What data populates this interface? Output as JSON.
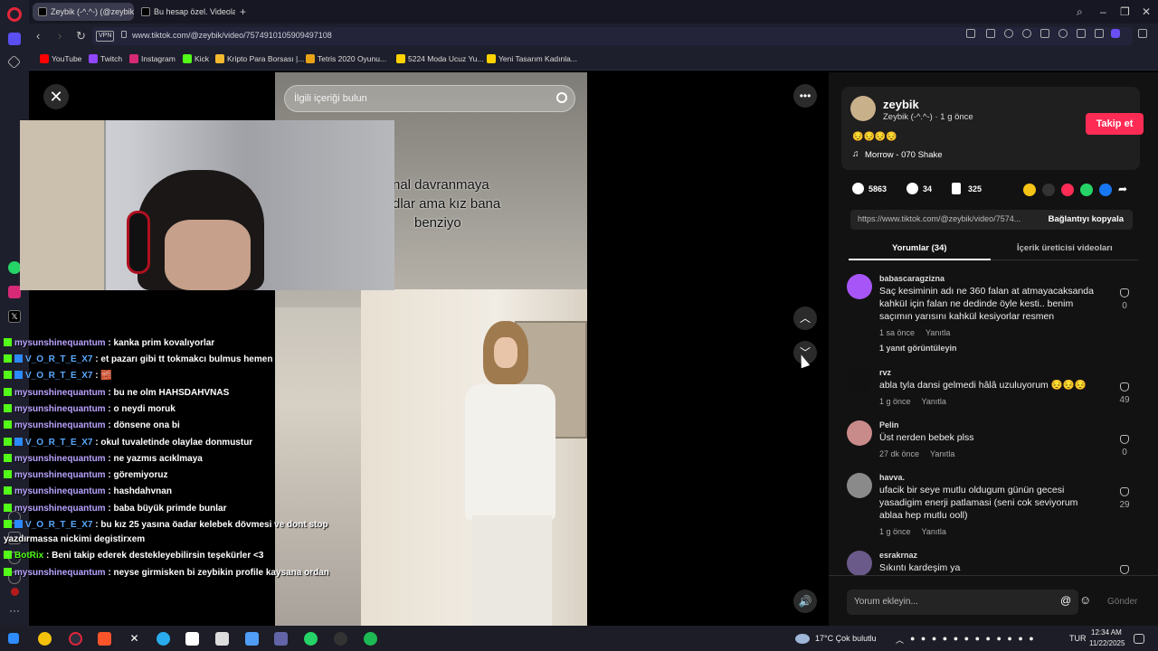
{
  "browser": {
    "tabs": [
      {
        "label": "Zeybik (-^.^-) (@zeybik"
      },
      {
        "label": "Bu hesap özel. Videoların"
      }
    ],
    "new_tab": "+",
    "url": "www.tiktok.com/@zeybik/video/7574910105909497108",
    "vpn": "VPN",
    "bookmarks": [
      "YouTube",
      "Twitch",
      "Instagram",
      "Kick",
      "Kripto Para Borsası |...",
      "Tetris 2020 Oyunu...",
      "5224 Moda Ucuz Yu...",
      "Yeni Tasarım Kadınla..."
    ]
  },
  "video": {
    "search_placeholder": "İlgili içeriği bulun",
    "caption_lines": [
      "nal davranmaya",
      "dlar ama kız bana",
      "benziyo"
    ]
  },
  "chat": [
    {
      "user": "mysunshinequantum",
      "text": ": kanka prim kovalıyorlar",
      "badge": "k",
      "color": "#b9a3ff"
    },
    {
      "user": "V_O_R_T_E_X7",
      "text": ": et pazarı gibi tt tokmakcı bulmus hemen",
      "badge": "kv",
      "color": "#59a9ff"
    },
    {
      "user": "V_O_R_T_E_X7",
      "text": ": 🧱",
      "badge": "kv",
      "color": "#59a9ff"
    },
    {
      "user": "mysunshinequantum",
      "text": ": bu ne olm HAHSDAHVNAS",
      "badge": "k",
      "color": "#b9a3ff"
    },
    {
      "user": "mysunshinequantum",
      "text": ": o neydi moruk",
      "badge": "k",
      "color": "#b9a3ff"
    },
    {
      "user": "mysunshinequantum",
      "text": ": dönsene ona bi",
      "badge": "k",
      "color": "#b9a3ff"
    },
    {
      "user": "V_O_R_T_E_X7",
      "text": ": okul tuvaletinde olaylae donmustur",
      "badge": "kv",
      "color": "#59a9ff"
    },
    {
      "user": "mysunshinequantum",
      "text": ": ne yazmıs acıklmaya",
      "badge": "k",
      "color": "#b9a3ff"
    },
    {
      "user": "mysunshinequantum",
      "text": ": göremiyoruz",
      "badge": "k",
      "color": "#b9a3ff"
    },
    {
      "user": "mysunshinequantum",
      "text": ": hashdahvnan",
      "badge": "k",
      "color": "#b9a3ff"
    },
    {
      "user": "mysunshinequantum",
      "text": ": baba büyük primde bunlar",
      "badge": "k",
      "color": "#b9a3ff"
    },
    {
      "user": "V_O_R_T_E_X7",
      "text": ": bu kız 25 yasına öadar kelebek dövmesi ve dont stop",
      "badge": "kv",
      "color": "#59a9ff"
    },
    {
      "user": "",
      "text": "yazdırmassa nickimi degistirxem",
      "badge": "",
      "color": "#ffffff"
    },
    {
      "user": "BotRix",
      "text": ": Beni takip ederek destekleyebilirsin teşekürler <3",
      "badge": "k",
      "color": "#53fc18"
    },
    {
      "user": "mysunshinequantum",
      "text": ": neyse girmisken bi zeybikin profile kaysana ordan",
      "badge": "k",
      "color": "#b9a3ff"
    }
  ],
  "panel": {
    "username": "zeybik",
    "subtitle": "Zeybik (-^.^-) · 1 g önce",
    "follow": "Takip et",
    "emojis": "😔😔😔😔",
    "music": "Morrow - 070 Shake",
    "likes": "5863",
    "comments_count": "34",
    "saves": "325",
    "link": "https://www.tiktok.com/@zeybik/video/7574...",
    "copy": "Bağlantıyı kopyala",
    "tab_comments": "Yorumlar (34)",
    "tab_creator": "İçerik üreticisi videoları",
    "comments": [
      {
        "name": "babascaragzizna",
        "text": "Saç kesiminin adı ne 360 falan at atmayacaksanda kahküI için falan ne dedinde öyle kesti.. benim saçımın yarısını kahkül kesiyorlar resmen",
        "time": "1 sa önce",
        "reply": "Yanıtla",
        "likes": "0",
        "more": "1 yanıt görüntüleyin",
        "color": "#a855f7"
      },
      {
        "name": "rvz",
        "text": "abla tyla dansi gelmedi hâlâ uzuluyorum 😔😔😔",
        "time": "1 g önce",
        "reply": "Yanıtla",
        "likes": "49",
        "more": "",
        "color": "#111111"
      },
      {
        "name": "Pelin",
        "text": "Üst nerden bebek plss",
        "time": "27 dk önce",
        "reply": "Yanıtla",
        "likes": "0",
        "more": "",
        "color": "#c98a8a"
      },
      {
        "name": "havva.",
        "text": "ufacik bir seye mutlu oldugum günün gecesi yasadigim enerji patlamasi (seni cok seviyorum ablaa hep mutlu ooll)",
        "time": "1 g önce",
        "reply": "Yanıtla",
        "likes": "29",
        "more": "",
        "color": "#8a8a8a"
      },
      {
        "name": "esrakrnaz",
        "text": "Sıkıntı kardeşim ya",
        "time": "",
        "reply": "",
        "likes": "",
        "more": "",
        "color": "#6a5a8a"
      }
    ],
    "add_comment": "Yorum ekleyin...",
    "send": "Gönder"
  },
  "taskbar": {
    "weather": "17°C  Çok bulutlu",
    "lang": "TUR",
    "time": "12:34 AM",
    "date": "11/22/2025"
  }
}
